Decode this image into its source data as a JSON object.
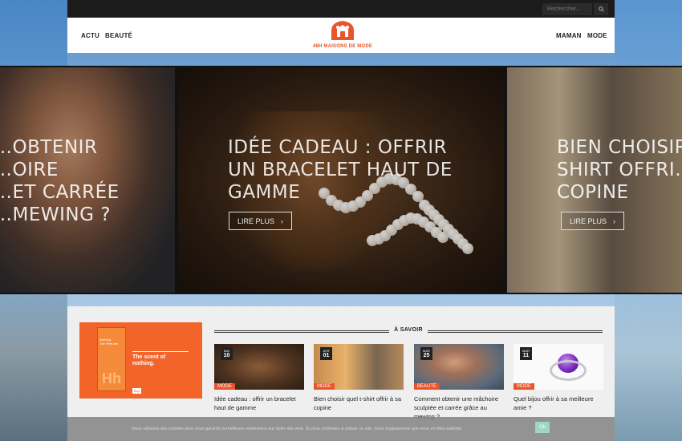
{
  "search": {
    "placeholder": "Rechercher..."
  },
  "nav": {
    "left": [
      "ACTU",
      "BEAUTÉ"
    ],
    "right": [
      "MAMAN",
      "MODE"
    ],
    "logo_text": "48H MAISONS DE MODE"
  },
  "slides": [
    {
      "title": "…OBTENIR\n…OIRE\n…ET CARRÉE\n…MEWING ?"
    },
    {
      "title": "IDÉE CADEAU : OFFRIR\nUN BRACELET HAUT DE\nGAMME",
      "button": "LIRE PLUS"
    },
    {
      "title": "BIEN CHOISIR…\nSHIRT OFFRI…\nCOPINE",
      "button": "LIRE PLUS"
    }
  ],
  "ad": {
    "bottle_text": "Nothing\nThe Perfume",
    "logo": "Hh",
    "tagline": "The scent of\nnothing.",
    "button": "Buy"
  },
  "section": {
    "title": "À SAVOIR"
  },
  "cards": [
    {
      "month": "MAI",
      "day": "10",
      "tag": "MODE",
      "title": "Idée cadeau : offrir un bracelet haut de gamme"
    },
    {
      "month": "AVR",
      "day": "01",
      "tag": "MODE",
      "title": "Bien choisir quel t-shirt offrir à sa copine"
    },
    {
      "month": "MAR",
      "day": "25",
      "tag": "BEAUTÉ",
      "title": "Comment obtenir une mâchoire sculptée et carrée grâce au mewing ?"
    },
    {
      "month": "MAR",
      "day": "11",
      "tag": "MODE",
      "title": "Quel bijou offrir à sa meilleure amie ?"
    }
  ],
  "cookie": {
    "text": "Nous utilisons des cookies pour vous garantir la meilleure expérience sur notre site web. Si vous continuez à utiliser ce site, nous supposerons que vous en êtes satisfait.",
    "button": "Ok"
  },
  "colors": {
    "accent": "#e8542b",
    "dark": "#1b1b1b",
    "cookie_btn": "#9ed7c2"
  }
}
